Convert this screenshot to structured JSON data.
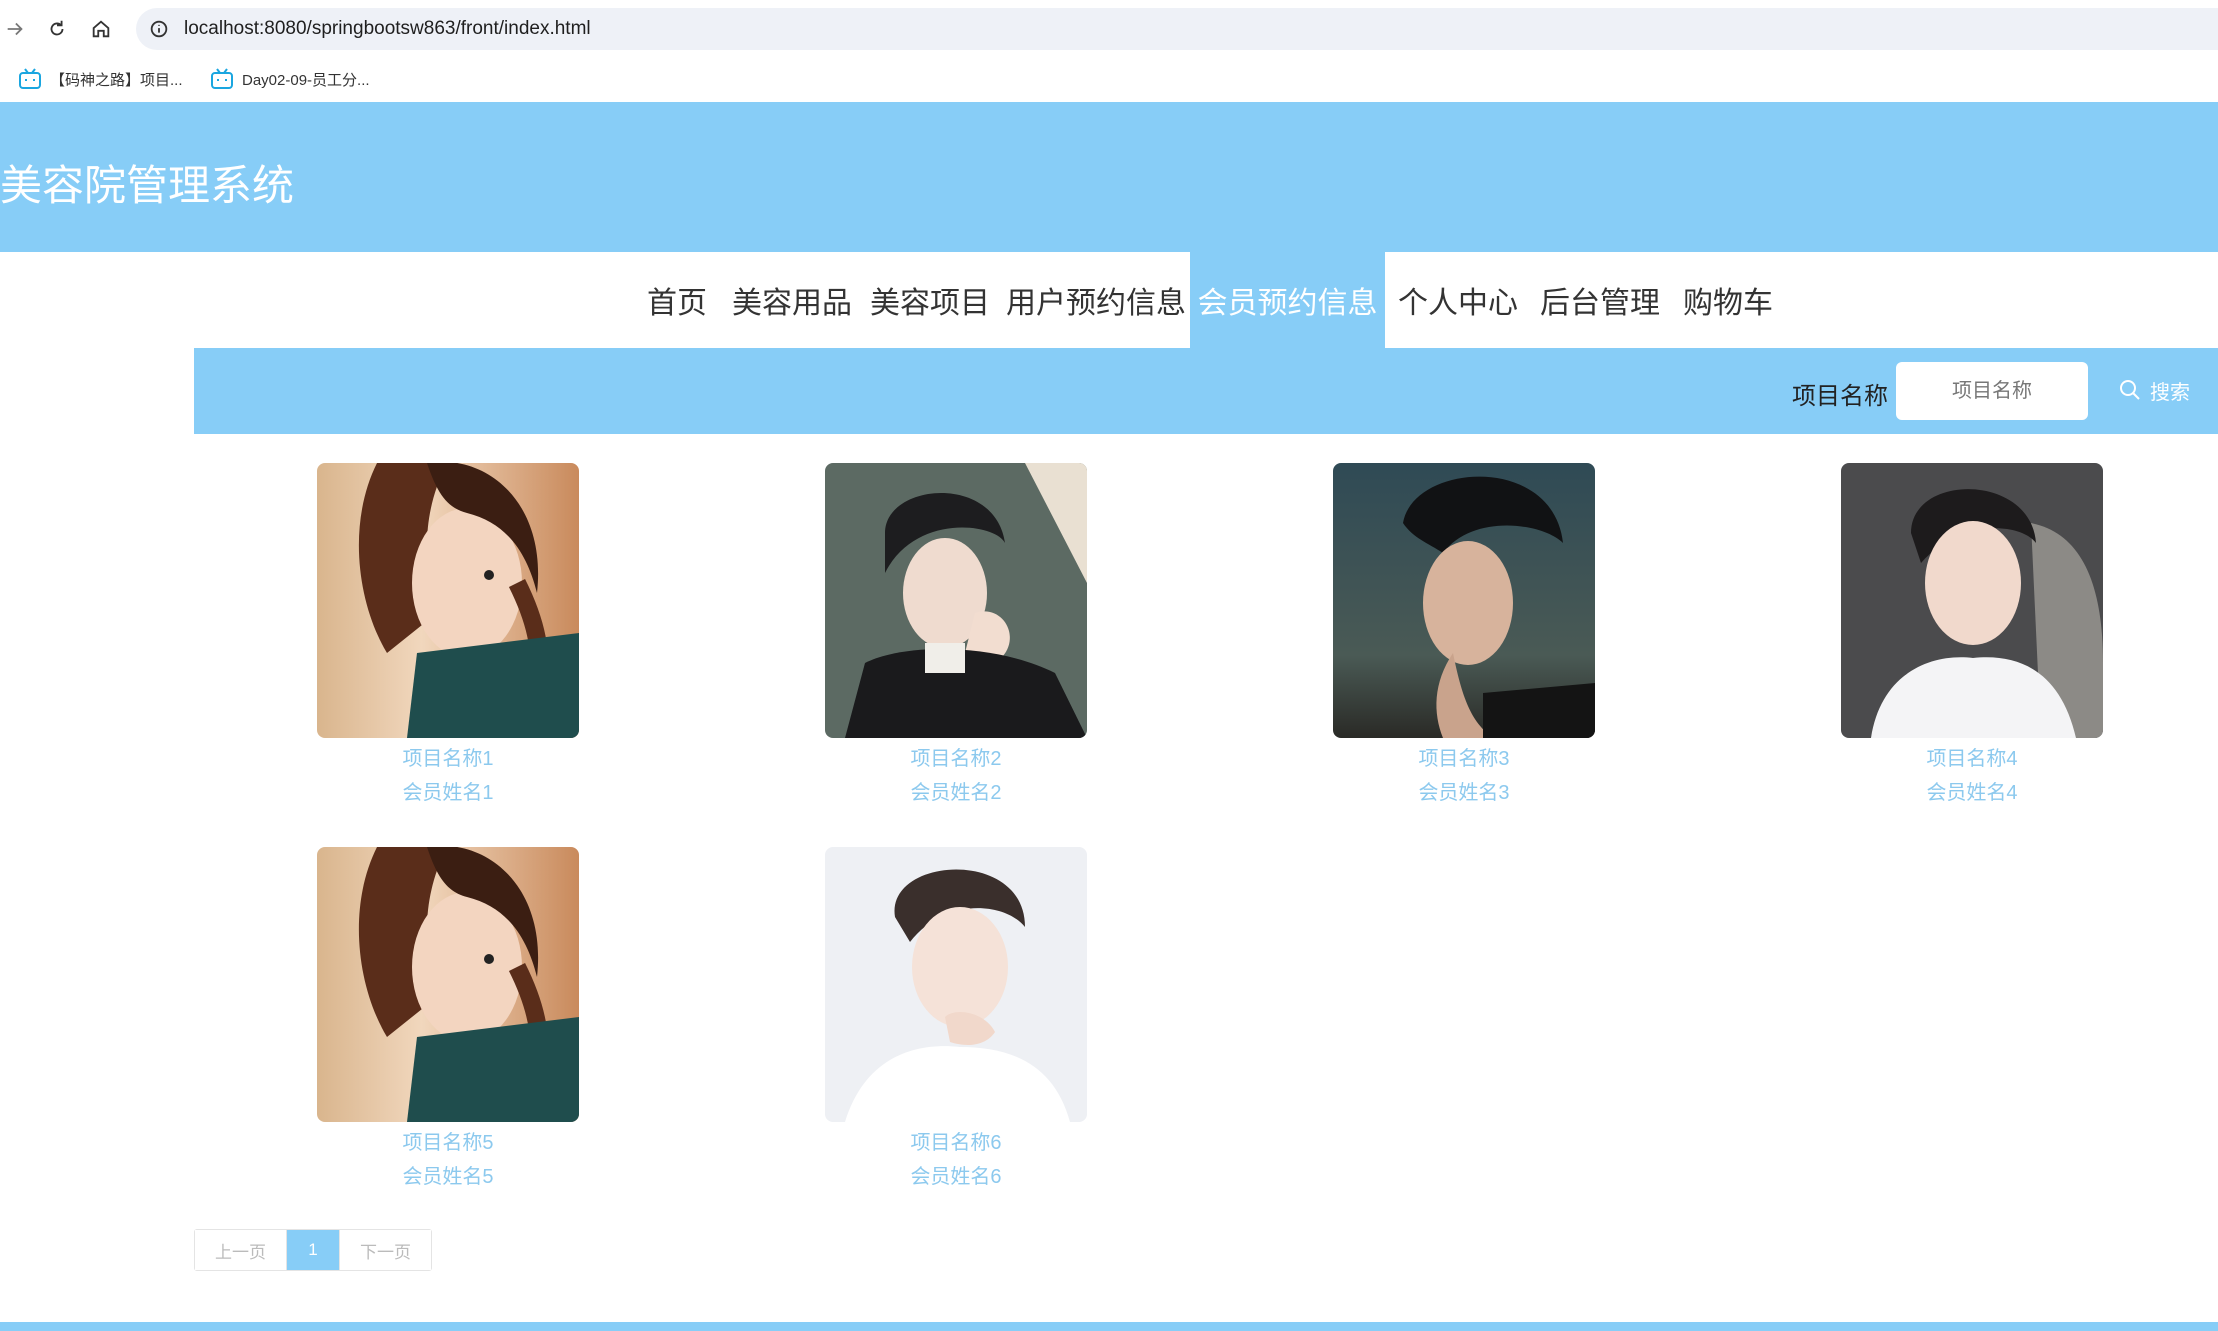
{
  "browser": {
    "url": "localhost:8080/springbootsw863/front/index.html",
    "bookmarks": [
      {
        "label": "【码神之路】项目..."
      },
      {
        "label": "Day02-09-员工分..."
      }
    ]
  },
  "site": {
    "title": "美容院管理系统"
  },
  "nav": {
    "items": [
      {
        "label": "首页"
      },
      {
        "label": "美容用品"
      },
      {
        "label": "美容项目"
      },
      {
        "label": "用户预约信息"
      },
      {
        "label": "会员预约信息"
      },
      {
        "label": "个人中心"
      },
      {
        "label": "后台管理"
      },
      {
        "label": "购物车"
      }
    ],
    "active_index": 4
  },
  "search": {
    "label": "项目名称",
    "placeholder": "项目名称",
    "button_label": "搜索"
  },
  "cards": [
    {
      "name": "项目名称1",
      "member": "会员姓名1"
    },
    {
      "name": "项目名称2",
      "member": "会员姓名2"
    },
    {
      "name": "项目名称3",
      "member": "会员姓名3"
    },
    {
      "name": "项目名称4",
      "member": "会员姓名4"
    },
    {
      "name": "项目名称5",
      "member": "会员姓名5"
    },
    {
      "name": "项目名称6",
      "member": "会员姓名6"
    }
  ],
  "pagination": {
    "prev_label": "上一页",
    "current": "1",
    "next_label": "下一页"
  },
  "colors": {
    "accent": "#87cdf7",
    "link": "#8cc9ee"
  }
}
